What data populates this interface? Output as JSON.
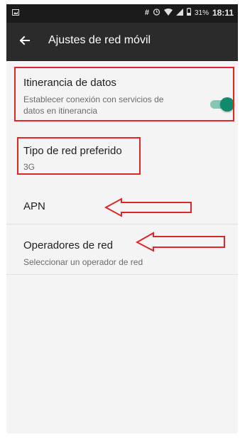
{
  "status_bar": {
    "icons": [
      "image-icon",
      "hash-icon",
      "alarm-icon",
      "wifi-icon",
      "signal-icon",
      "battery-icon"
    ],
    "battery_percent": "31%",
    "time": "18:11"
  },
  "app_bar": {
    "back_icon": "arrow-left-icon",
    "title": "Ajustes de red móvil"
  },
  "settings": {
    "roaming": {
      "title": "Itinerancia de datos",
      "summary": "Establecer conexión con servicios de datos en itinerancia",
      "enabled": true
    },
    "preferred_network": {
      "title": "Tipo de red preferido",
      "value": "3G"
    },
    "apn": {
      "title": "APN"
    },
    "operators": {
      "title": "Operadores de red",
      "summary": "Seleccionar un operador de red"
    }
  },
  "annotations": {
    "highlight_color": "#e0252b",
    "toggle_on_color": "#0f8a6d"
  }
}
